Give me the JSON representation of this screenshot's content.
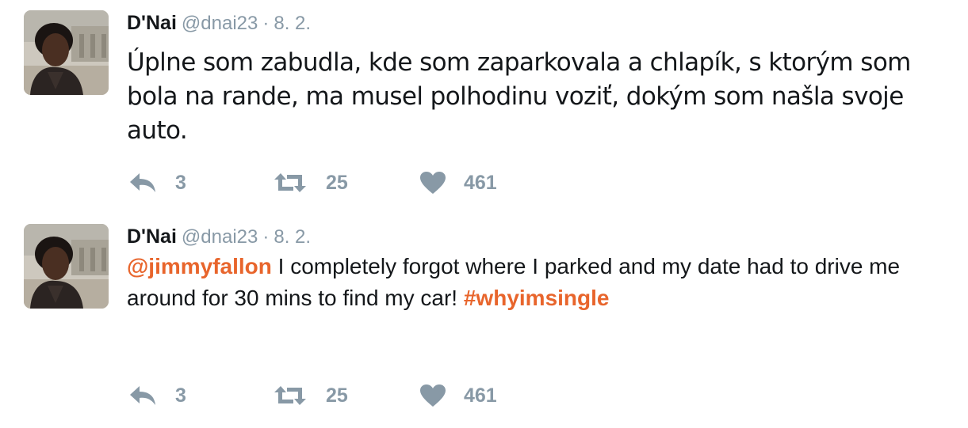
{
  "colors": {
    "link": "#e8652c",
    "meta": "#8899a6",
    "text": "#14171a"
  },
  "tweets": [
    {
      "display_name": "D'Nai",
      "handle": "@dnai23",
      "separator": "·",
      "date": "8. 2.",
      "text": "Úplne som zabudla, kde som zaparkovala a chlapík, s ktorým som bola na rande, ma musel polhodinu voziť, dokým som našla svoje auto.",
      "actions": {
        "reply_icon": "reply-icon",
        "reply_count": "3",
        "retweet_icon": "retweet-icon",
        "retweet_count": "25",
        "like_icon": "heart-icon",
        "like_count": "461"
      }
    },
    {
      "display_name": "D'Nai",
      "handle": "@dnai23",
      "separator": "·",
      "date": "8. 2.",
      "mention": "@jimmyfallon",
      "text_part1": " I completely forgot where I parked and my date had to drive me around for 30 mins to find my car! ",
      "hashtag": "#whyimsingle",
      "actions": {
        "reply_icon": "reply-icon",
        "reply_count": "3",
        "retweet_icon": "retweet-icon",
        "retweet_count": "25",
        "like_icon": "heart-icon",
        "like_count": "461"
      }
    }
  ]
}
